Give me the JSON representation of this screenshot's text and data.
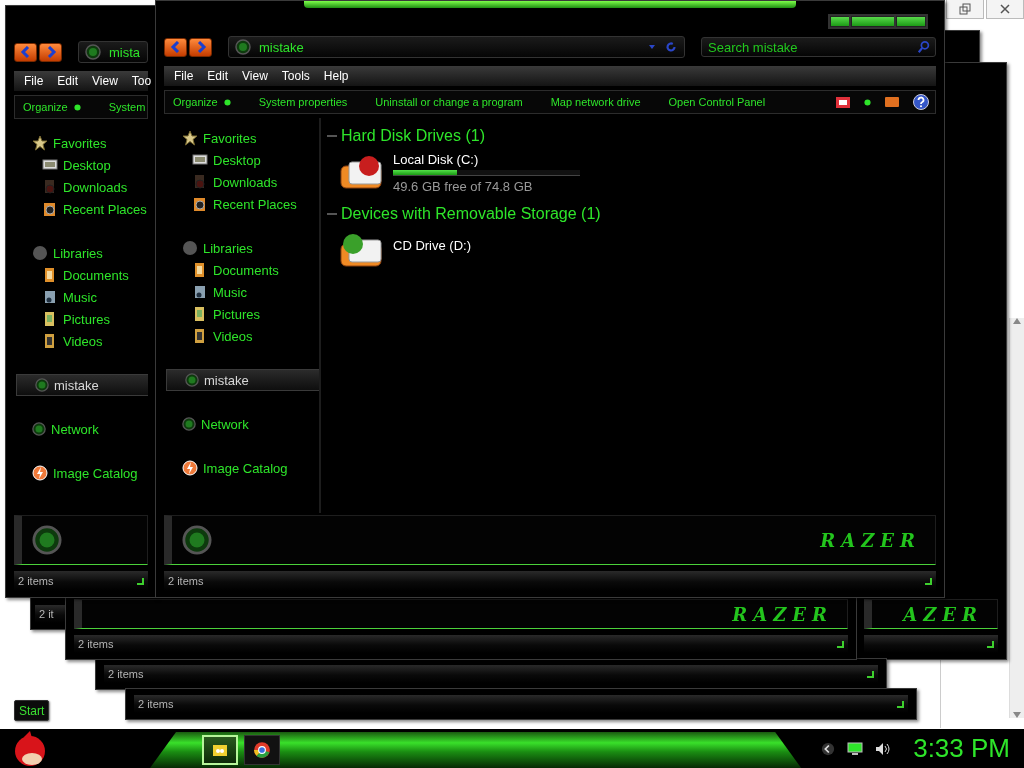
{
  "desktop": {
    "start_label": "Start"
  },
  "background_windows": [
    {
      "status": "2 it"
    },
    {
      "status": "2 items",
      "logo": "RAZER"
    },
    {
      "status": "2 items"
    },
    {
      "status": "2 items"
    }
  ],
  "right_window": {
    "logo": "AZER"
  },
  "left_window": {
    "address": "mista",
    "menu": [
      "File",
      "Edit",
      "View",
      "Too"
    ],
    "toolbar": [
      {
        "label": "Organize",
        "kind": "menu"
      },
      {
        "label": "System",
        "kind": "command"
      }
    ],
    "sidebar": [
      {
        "label": "Favorites",
        "kind": "favorites",
        "selected": false,
        "children": [
          {
            "label": "Desktop",
            "kind": "desktop",
            "selected": false
          },
          {
            "label": "Downloads",
            "kind": "downloads",
            "selected": false
          },
          {
            "label": "Recent Places",
            "kind": "recent",
            "selected": false
          }
        ]
      },
      {
        "label": "Libraries",
        "kind": "libraries",
        "selected": false,
        "children": [
          {
            "label": "Documents",
            "kind": "documents",
            "selected": false
          },
          {
            "label": "Music",
            "kind": "music",
            "selected": false
          },
          {
            "label": "Pictures",
            "kind": "pictures",
            "selected": false
          },
          {
            "label": "Videos",
            "kind": "videos",
            "selected": false
          }
        ]
      },
      {
        "label": "mistake",
        "kind": "homegroup",
        "selected": true
      },
      {
        "label": "Network",
        "kind": "network",
        "selected": false
      },
      {
        "label": "Image Catalog",
        "kind": "catalog",
        "selected": false
      }
    ],
    "status": "2 items"
  },
  "main_window": {
    "address": "mistake",
    "search_placeholder": "Search mistake",
    "menu": [
      "File",
      "Edit",
      "View",
      "Tools",
      "Help"
    ],
    "toolbar": [
      {
        "label": "Organize",
        "kind": "menu"
      },
      {
        "label": "System properties",
        "kind": "command"
      },
      {
        "label": "Uninstall or change a program",
        "kind": "command"
      },
      {
        "label": "Map network drive",
        "kind": "command"
      },
      {
        "label": "Open Control Panel",
        "kind": "command"
      }
    ],
    "sidebar": [
      {
        "label": "Favorites",
        "kind": "favorites",
        "selected": false,
        "children": [
          {
            "label": "Desktop",
            "kind": "desktop",
            "selected": false
          },
          {
            "label": "Downloads",
            "kind": "downloads",
            "selected": false
          },
          {
            "label": "Recent Places",
            "kind": "recent",
            "selected": false
          }
        ]
      },
      {
        "label": "Libraries",
        "kind": "libraries",
        "selected": false,
        "children": [
          {
            "label": "Documents",
            "kind": "documents",
            "selected": false
          },
          {
            "label": "Music",
            "kind": "music",
            "selected": false
          },
          {
            "label": "Pictures",
            "kind": "pictures",
            "selected": false
          },
          {
            "label": "Videos",
            "kind": "videos",
            "selected": false
          }
        ]
      },
      {
        "label": "mistake",
        "kind": "homegroup",
        "selected": true
      },
      {
        "label": "Network",
        "kind": "network",
        "selected": false
      },
      {
        "label": "Image Catalog",
        "kind": "catalog",
        "selected": false
      }
    ],
    "content": {
      "groups": [
        {
          "title": "Hard Disk Drives (1)",
          "items": [
            {
              "name": "Local Disk (C:)",
              "kind": "hdd",
              "level": 0.34,
              "free": "49.6 GB free of 74.8 GB"
            }
          ]
        },
        {
          "title": "Devices with Removable Storage (1)",
          "items": [
            {
              "name": "CD Drive (D:)",
              "kind": "cd"
            }
          ]
        }
      ]
    },
    "details_logo": "RAZER",
    "status": "2 items"
  },
  "taskbar": {
    "buttons": [
      {
        "kind": "folder",
        "selected": true
      },
      {
        "kind": "browser",
        "selected": false
      }
    ],
    "clock": "3:33 PM"
  }
}
